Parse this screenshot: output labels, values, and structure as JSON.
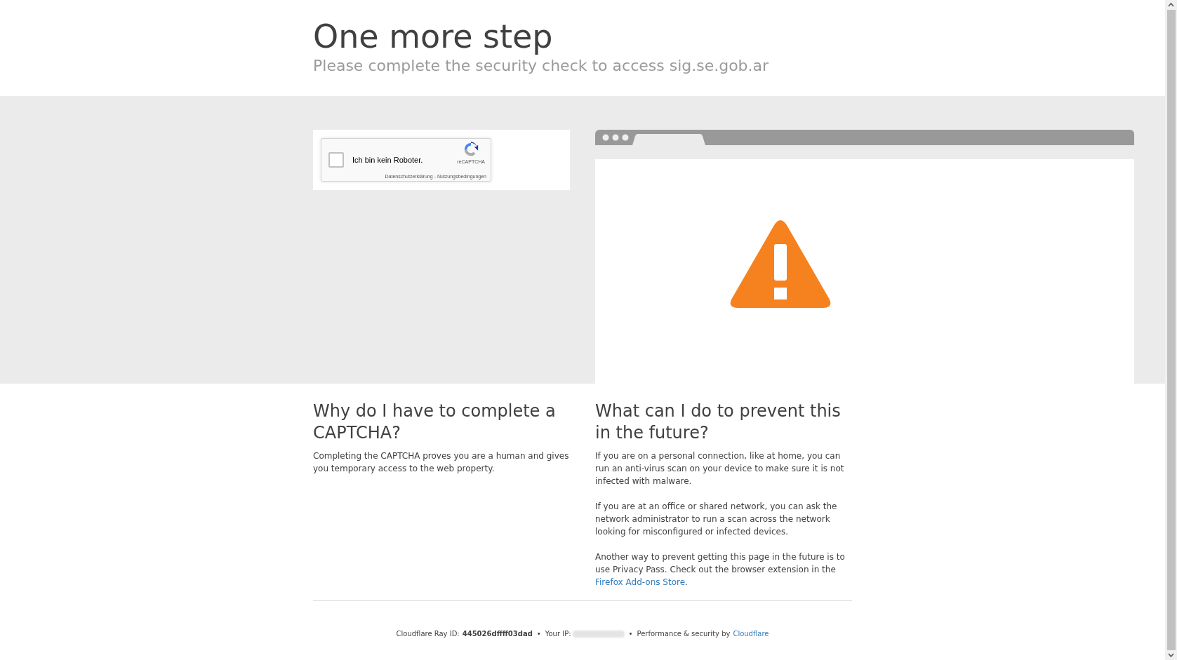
{
  "header": {
    "title": "One more step",
    "subtitle": "Please complete the security check to access sig.se.gob.ar"
  },
  "captcha": {
    "checked": false,
    "label": "Ich bin kein Roboter.",
    "brand": "reCAPTCHA",
    "privacy": "Datenschutzerklärung",
    "separator": "-",
    "terms": "Nutzungsbedingungen"
  },
  "sections": [
    {
      "heading": "Why do I have to complete a CAPTCHA?",
      "paragraphs": [
        {
          "text": "Completing the CAPTCHA proves you are a human and gives you temporary access to the web property."
        }
      ]
    },
    {
      "heading": "What can I do to prevent this in the future?",
      "paragraphs": [
        {
          "text": "If you are on a personal connection, like at home, you can run an anti-virus scan on your device to make sure it is not infected with malware."
        },
        {
          "text": "If you are at an office or shared network, you can ask the network administrator to run a scan across the network looking for misconfigured or infected devices."
        },
        {
          "text": "Another way to prevent getting this page in the future is to use Privacy Pass. Check out the browser extension in the",
          "link": "Firefox Add-ons Store",
          "after": "."
        }
      ]
    }
  ],
  "footer": {
    "ray_label": "Cloudflare Ray ID:",
    "ray_id": "445026dffff03dad",
    "ip_label": "Your IP:",
    "separator": "•",
    "perf": "Performance & security by",
    "link": "Cloudflare"
  }
}
